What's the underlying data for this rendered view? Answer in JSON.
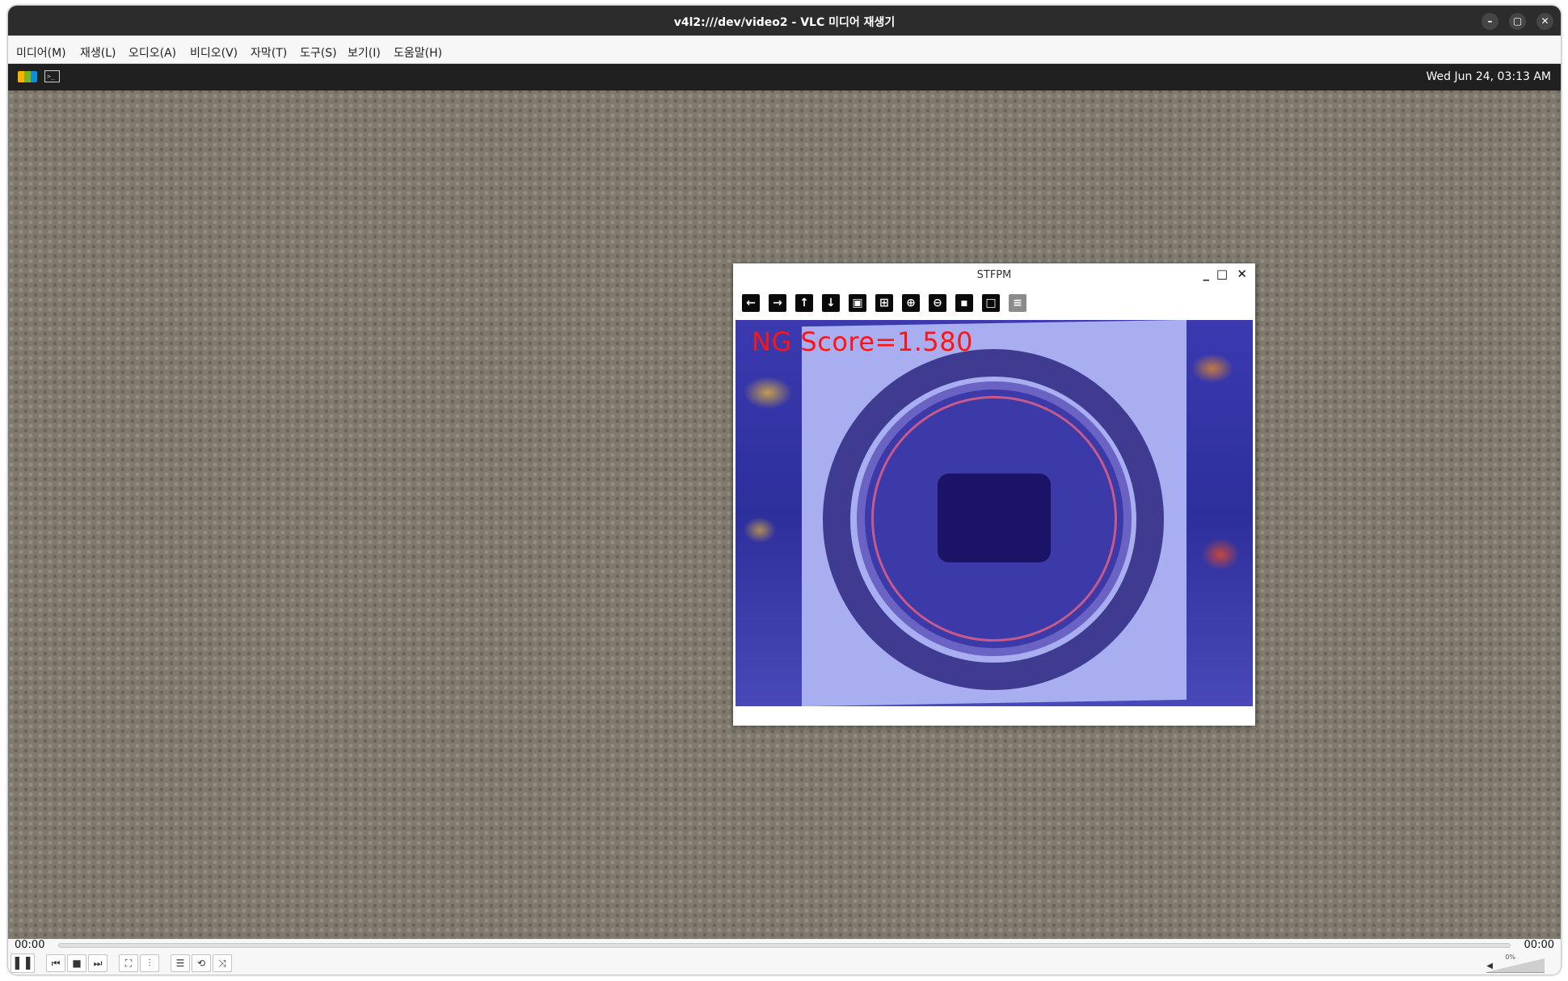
{
  "window": {
    "title": "v4l2:///dev/video2 - VLC 미디어 재생기",
    "minimize": "–",
    "maximize": "▢",
    "close": "✕"
  },
  "menu": [
    "미디어(M)",
    "재생(L)",
    "오디오(A)",
    "비디오(V)",
    "자막(T)",
    "도구(S)",
    "보기(I)",
    "도움말(H)"
  ],
  "topbar": {
    "clock": "Wed Jun 24, 03:13 AM",
    "nxp_logo": "nxp-logo",
    "terminal_icon": "terminal-icon"
  },
  "stfpm": {
    "title": "STFPM",
    "minimize": "_",
    "maximize": "□",
    "close": "✕",
    "score_text": "NG Score=1.580",
    "toolbar": [
      "arrow-left-icon",
      "arrow-right-icon",
      "arrow-up-icon",
      "arrow-down-icon",
      "image-icon",
      "image-save-icon",
      "zoom-in-icon",
      "zoom-out-icon",
      "save-icon",
      "window-icon",
      "properties-icon"
    ]
  },
  "playback": {
    "elapsed": "00:00",
    "total": "00:00",
    "volume_percent": "0%"
  },
  "colors": {
    "score_text": "#ff1414",
    "titlebar": "#2c2c2c"
  }
}
